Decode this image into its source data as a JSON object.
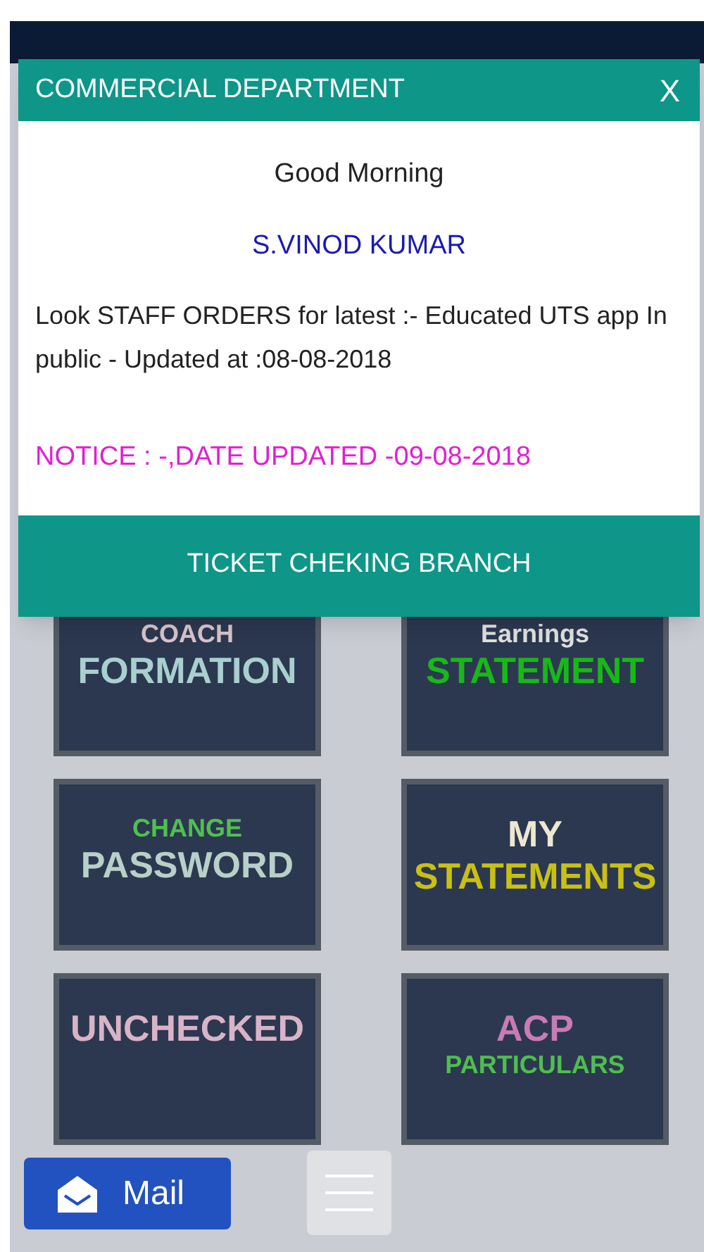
{
  "dialog": {
    "title": "COMMERCIAL DEPARTMENT",
    "close": "X",
    "greeting": "Good Morning",
    "user_name": "S.VINOD KUMAR",
    "message": "Look STAFF ORDERS for latest :- Educated UTS app In public - Updated at :08-08-2018",
    "notice": "NOTICE : -,DATE UPDATED -09-08-2018",
    "footer_button": "TICKET CHEKING BRANCH"
  },
  "tiles": [
    {
      "lines": [
        {
          "text": "COACH",
          "color": "#d8c4cc",
          "kind": "small"
        },
        {
          "text": "FORMATION",
          "color": "#a9cfcf",
          "kind": "big"
        }
      ]
    },
    {
      "lines": [
        {
          "text": "Earnings",
          "color": "#e0e0e0",
          "kind": "small"
        },
        {
          "text": "STATEMENT",
          "color": "#18b818",
          "kind": "big"
        }
      ]
    },
    {
      "lines": [
        {
          "text": "CHANGE",
          "color": "#4fc04f",
          "kind": "small"
        },
        {
          "text": "PASSWORD",
          "color": "#b8d0c8",
          "kind": "big"
        }
      ]
    },
    {
      "lines": [
        {
          "text": "MY",
          "color": "#ede8cf",
          "kind": "big"
        },
        {
          "text": "STATEMENTS",
          "color": "#c8c014",
          "kind": "big"
        }
      ]
    },
    {
      "lines": [
        {
          "text": "UNCHECKED",
          "color": "#d9b3c8",
          "kind": "big"
        }
      ]
    },
    {
      "lines": [
        {
          "text": "ACP",
          "color": "#c87bb5",
          "kind": "big"
        },
        {
          "text": "PARTICULARS",
          "color": "#4fbe4f",
          "kind": "small"
        }
      ]
    }
  ],
  "mail_button": "Mail"
}
